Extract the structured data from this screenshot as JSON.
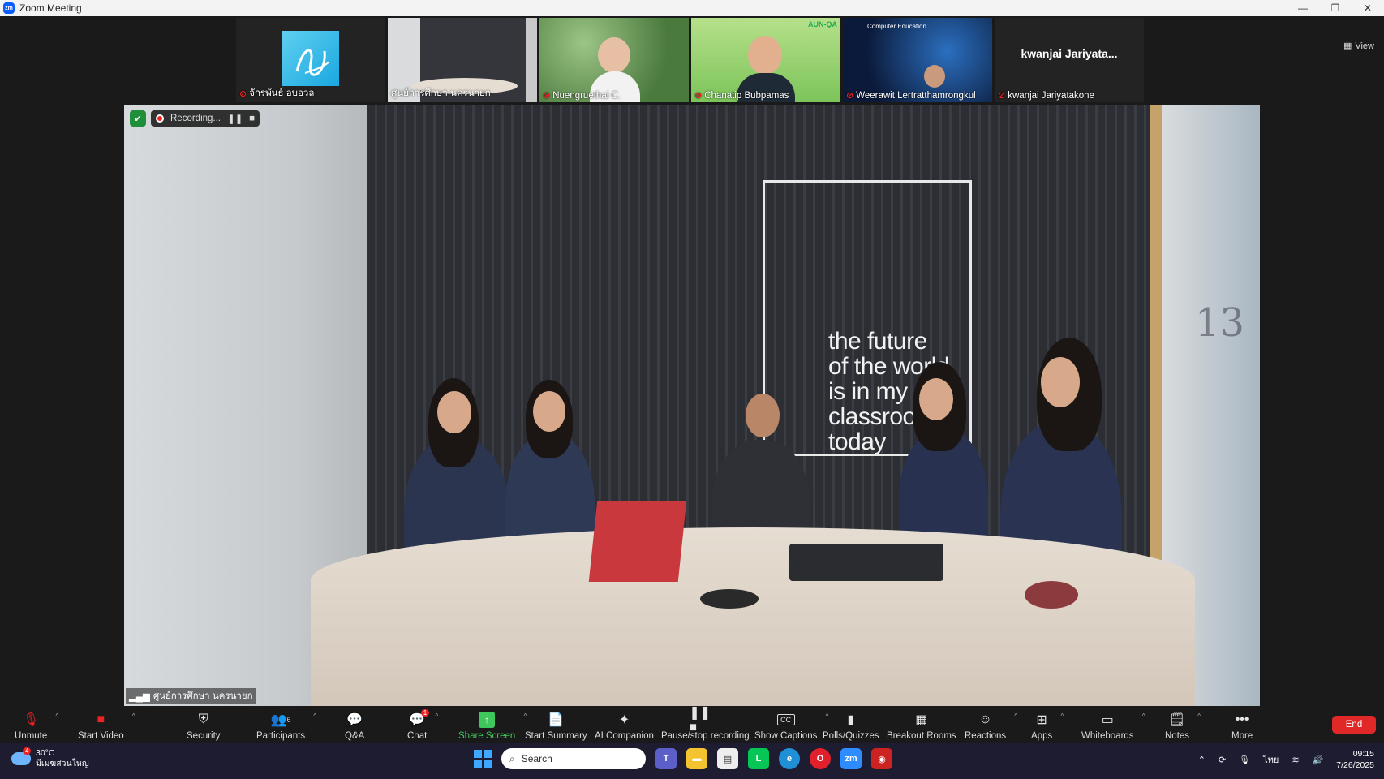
{
  "window": {
    "logo_text": "zm",
    "title": "Zoom Meeting",
    "controls": [
      "—",
      "❐",
      "✕"
    ]
  },
  "gallery": {
    "tiles": [
      {
        "name": "จักรพันธ์ อบอวล"
      },
      {
        "name": "ศูนย์การศึกษา นครนายก"
      },
      {
        "name": "Nuengruethai C."
      },
      {
        "name": "Chanatip Bubpamas",
        "banner": "AUN-QA"
      },
      {
        "name": "Weerawit Lertratthamrongkul",
        "banner": "Computer Education"
      },
      {
        "name": "kwanjai Jariyatakone",
        "display_name": "kwanjai  Jariyata..."
      }
    ],
    "view_label": "View"
  },
  "main": {
    "recording_label": "Recording...",
    "speaker_label": "ศูนย์การศึกษา นครนายก",
    "slogan": [
      "the future",
      "of the world",
      "is in my",
      "classroo",
      "today"
    ],
    "glass_text": "13"
  },
  "toolbar": {
    "items": [
      {
        "label": "Unmute",
        "icon": "mic-off-icon"
      },
      {
        "label": "Start Video",
        "icon": "video-off-icon"
      },
      {
        "label": "Security",
        "icon": "shield-icon"
      },
      {
        "label": "Participants",
        "icon": "participants-icon",
        "count": "6"
      },
      {
        "label": "Q&A",
        "icon": "qa-icon"
      },
      {
        "label": "Chat",
        "icon": "chat-icon",
        "badge": "1"
      },
      {
        "label": "Share Screen",
        "icon": "share-screen-icon"
      },
      {
        "label": "Start Summary",
        "icon": "summary-icon"
      },
      {
        "label": "AI Companion",
        "icon": "ai-companion-icon"
      },
      {
        "label": "Pause/stop recording",
        "icon": "pause-stop-icon"
      },
      {
        "label": "Show Captions",
        "icon": "captions-icon",
        "glyph": "CC"
      },
      {
        "label": "Polls/Quizzes",
        "icon": "polls-icon"
      },
      {
        "label": "Breakout Rooms",
        "icon": "breakout-icon"
      },
      {
        "label": "Reactions",
        "icon": "reactions-icon"
      },
      {
        "label": "Apps",
        "icon": "apps-icon"
      },
      {
        "label": "Whiteboards",
        "icon": "whiteboard-icon"
      },
      {
        "label": "Notes",
        "icon": "notes-icon"
      },
      {
        "label": "More",
        "icon": "more-icon"
      }
    ],
    "end_label": "End"
  },
  "taskbar": {
    "weather": {
      "temp": "30°C",
      "desc": "มีเมฆส่วนใหญ่",
      "badge": "4"
    },
    "search_placeholder": "Search",
    "language": "ไทย",
    "time": "09:15",
    "date": "7/26/2025"
  },
  "colors": {
    "accent_green": "#3ec75a",
    "end_red": "#e02828",
    "zoom_blue": "#0b5cff",
    "muted_red": "#e22222"
  }
}
